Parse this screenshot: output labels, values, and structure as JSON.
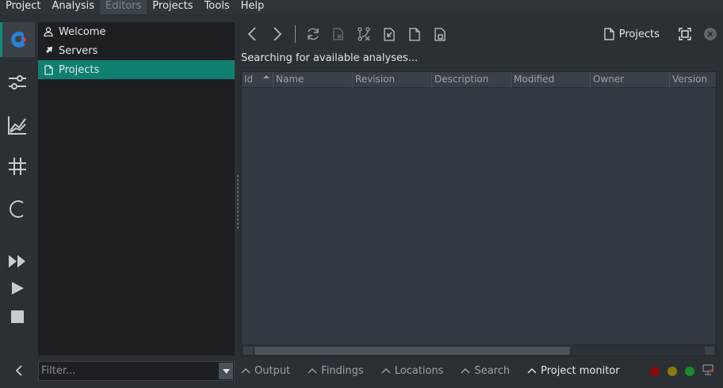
{
  "menu": [
    {
      "label": "Project",
      "disabled": false
    },
    {
      "label": "Analysis",
      "disabled": false
    },
    {
      "label": "Editors",
      "disabled": true
    },
    {
      "label": "Projects",
      "disabled": false
    },
    {
      "label": "Tools",
      "disabled": false
    },
    {
      "label": "Help",
      "disabled": false
    }
  ],
  "modes": [
    {
      "name": "app-logo-icon",
      "active": true
    },
    {
      "name": "sliders-icon",
      "active": false
    },
    {
      "name": "chart-icon",
      "active": false
    },
    {
      "name": "hash-icon",
      "active": false
    },
    {
      "name": "refresh-arc-icon",
      "active": false
    },
    {
      "name": "fast-forward-icon",
      "active": false
    },
    {
      "name": "play-icon",
      "active": false
    },
    {
      "name": "stop-icon",
      "active": false
    }
  ],
  "nav": {
    "items": [
      {
        "label": "Welcome",
        "icon": "user-icon",
        "selected": false
      },
      {
        "label": "Servers",
        "icon": "plug-icon",
        "selected": false
      },
      {
        "label": "Projects",
        "icon": "document-icon",
        "selected": true
      }
    ]
  },
  "toolbar": {
    "projects_label": "Projects"
  },
  "status_message": "Searching for available analyses...",
  "table": {
    "columns": [
      {
        "label": "Id",
        "sorted": true
      },
      {
        "label": "Name",
        "sorted": false
      },
      {
        "label": "Revision",
        "sorted": false
      },
      {
        "label": "Description",
        "sorted": false
      },
      {
        "label": "Modified",
        "sorted": false
      },
      {
        "label": "Owner",
        "sorted": false
      },
      {
        "label": "Version",
        "sorted": false
      }
    ],
    "rows": []
  },
  "filter": {
    "placeholder": "Filter...",
    "value": ""
  },
  "output_panes": [
    {
      "label": "Output",
      "active": false
    },
    {
      "label": "Findings",
      "active": false
    },
    {
      "label": "Locations",
      "active": false
    },
    {
      "label": "Search",
      "active": false
    },
    {
      "label": "Project monitor",
      "active": true
    }
  ],
  "status_indicators": {
    "colors": [
      "#8b0a0a",
      "#8a7a10",
      "#1a8a2a"
    ]
  },
  "colors": {
    "accent": "#0f7f70",
    "background": "#2b3035",
    "panel": "#1d1f22"
  }
}
